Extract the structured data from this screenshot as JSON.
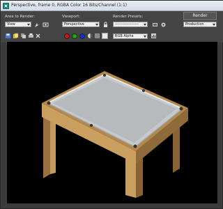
{
  "window": {
    "title": "Perspective, frame 0, RGBA Color 16 Bits/Channel (1:1)"
  },
  "toolbar": {
    "area_label": "Area to Render:",
    "area_value": "View",
    "viewport_label": "Viewport:",
    "viewport_value": "Perspective",
    "presets_label": "Render Presets:",
    "presets_value": "-------------------",
    "render_button": "Render",
    "mode_value": "Production",
    "channel_value": "RGB Alpha"
  },
  "icons": [
    "floppy-icon",
    "copy-icon",
    "clone-icon",
    "print-icon",
    "delete-icon",
    "lock-icon",
    "settings-icon",
    "teapot-icon"
  ],
  "colors": {
    "channel_red": "#e01010",
    "channel_green": "#10b010",
    "channel_blue": "#1030e0",
    "viewport_bg": "#000000",
    "table_wood": "#c49a5c",
    "table_felt": "#b8bcbf"
  }
}
